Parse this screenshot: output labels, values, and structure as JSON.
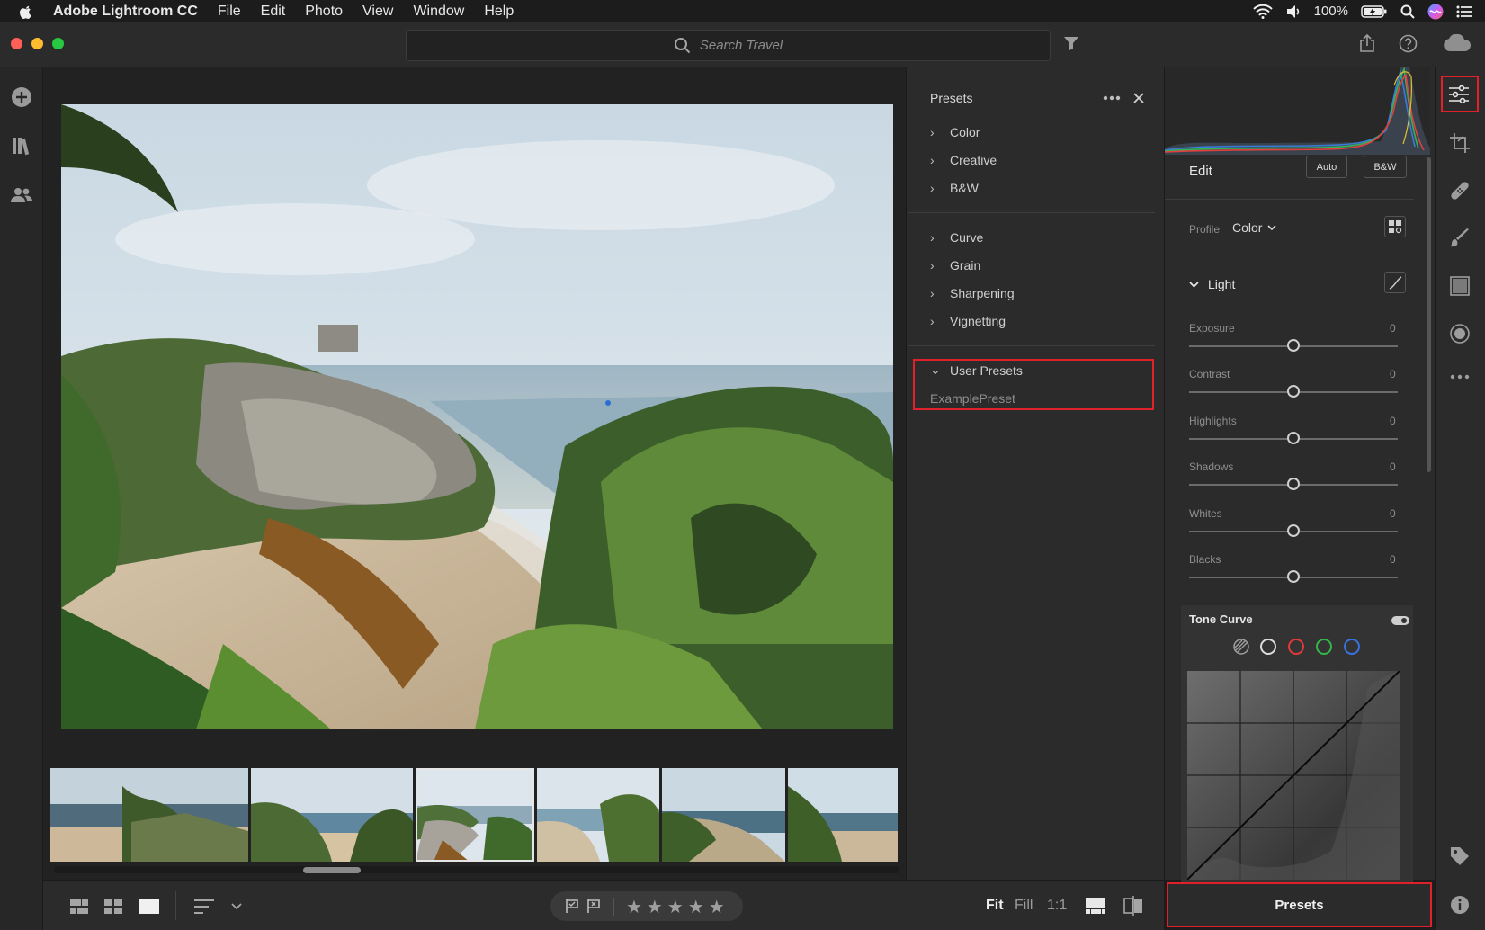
{
  "menubar": {
    "app_name": "Adobe Lightroom CC",
    "items": [
      "File",
      "Edit",
      "Photo",
      "View",
      "Window",
      "Help"
    ],
    "battery": "100%"
  },
  "search": {
    "placeholder": "Search Travel"
  },
  "presets_panel": {
    "title": "Presets",
    "group1": [
      "Color",
      "Creative",
      "B&W"
    ],
    "group2": [
      "Curve",
      "Grain",
      "Sharpening",
      "Vignetting"
    ],
    "user_presets_label": "User Presets",
    "user_preset_item": "ExamplePreset"
  },
  "edit_panel": {
    "title": "Edit",
    "auto_label": "Auto",
    "bw_label": "B&W",
    "profile_label": "Profile",
    "profile_value": "Color",
    "light_label": "Light",
    "sliders": [
      {
        "label": "Exposure",
        "value": "0"
      },
      {
        "label": "Contrast",
        "value": "0"
      },
      {
        "label": "Highlights",
        "value": "0"
      },
      {
        "label": "Shadows",
        "value": "0"
      },
      {
        "label": "Whites",
        "value": "0"
      },
      {
        "label": "Blacks",
        "value": "0"
      }
    ],
    "tone_curve_label": "Tone Curve",
    "presets_button": "Presets"
  },
  "bottombar": {
    "fit": "Fit",
    "fill": "Fill",
    "one_to_one": "1:1"
  },
  "colors": {
    "highlight": "#e0202a",
    "panel": "#2b2b2b",
    "background": "#1d1d1d"
  }
}
